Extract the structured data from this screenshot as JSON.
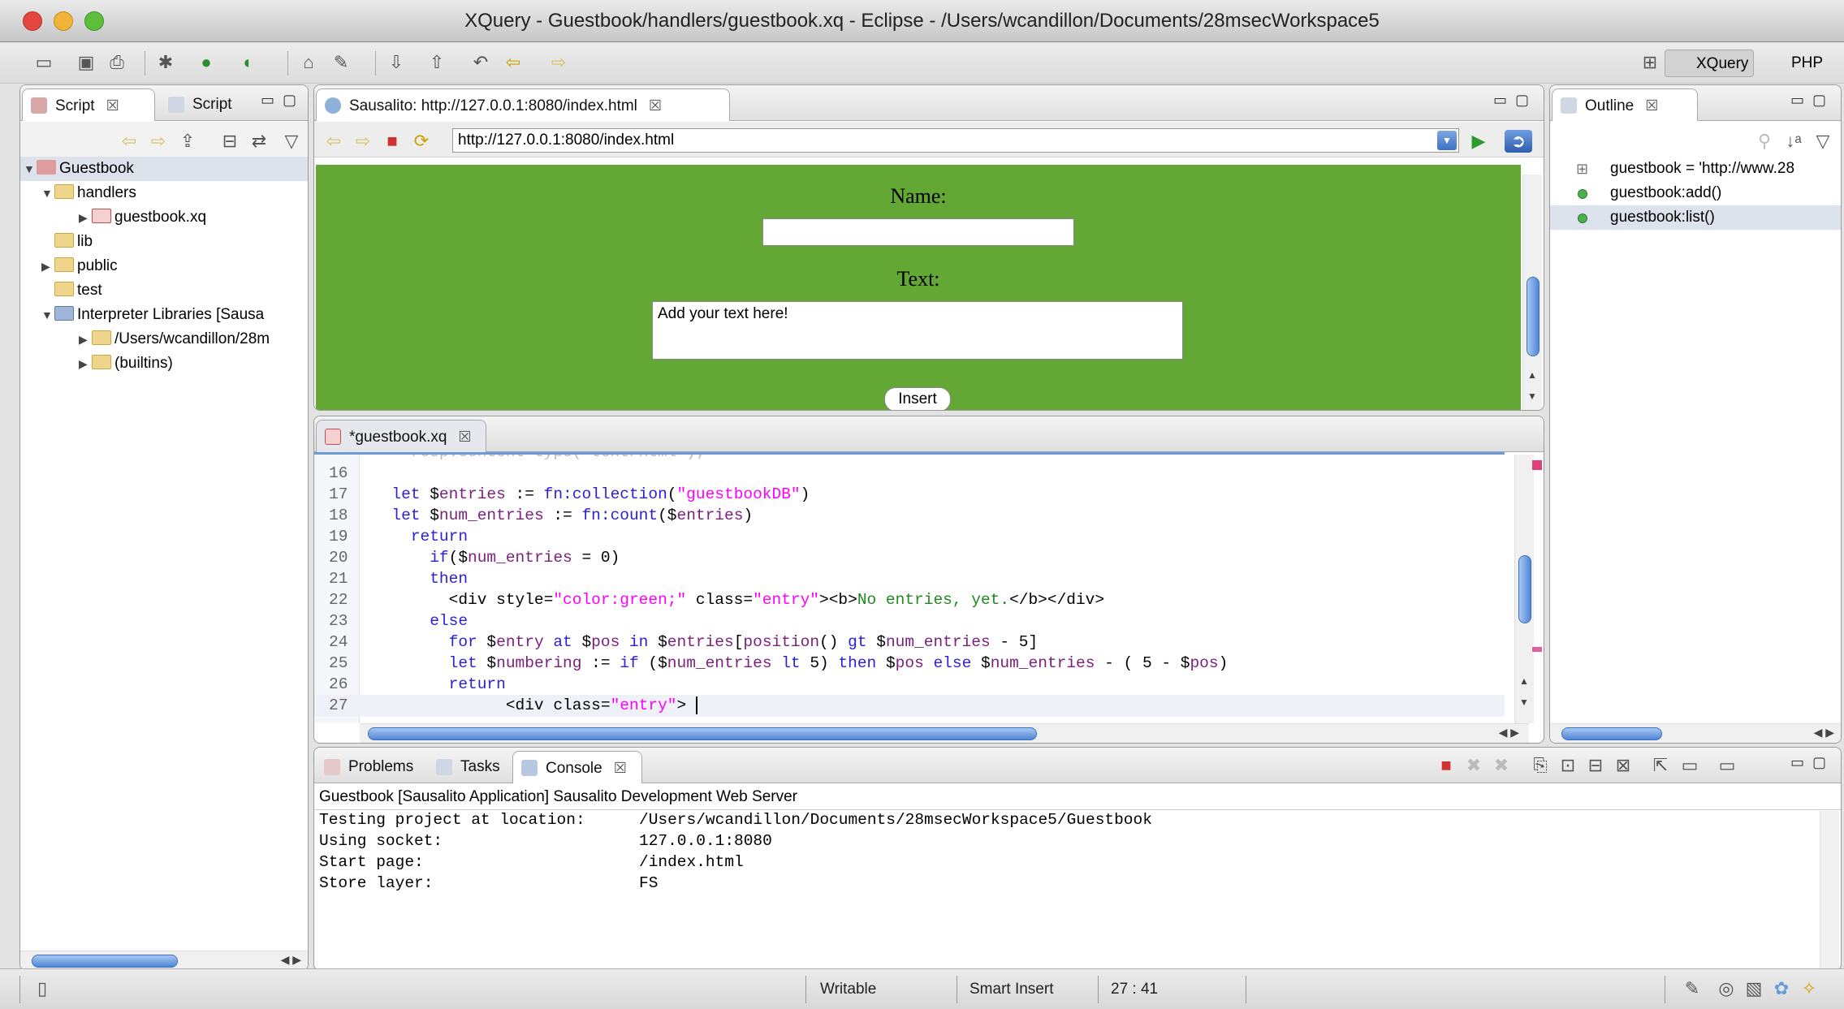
{
  "window": {
    "title": "XQuery - Guestbook/handlers/guestbook.xq - Eclipse - /Users/wcandillon/Documents/28msecWorkspace5"
  },
  "perspectives": {
    "xquery": "XQuery",
    "php": "PHP"
  },
  "left_panel": {
    "tabs": [
      {
        "label": "Script"
      },
      {
        "label": "Script"
      }
    ],
    "tree": [
      {
        "label": "Guestbook"
      },
      {
        "label": "handlers"
      },
      {
        "label": "guestbook.xq"
      },
      {
        "label": "lib"
      },
      {
        "label": "public"
      },
      {
        "label": "test"
      },
      {
        "label": "Interpreter Libraries [Sausa"
      },
      {
        "label": "/Users/wcandillon/28m"
      },
      {
        "label": "(builtins)"
      }
    ]
  },
  "browser": {
    "tab_label": "Sausalito: http://127.0.0.1:8080/index.html",
    "url": "http://127.0.0.1:8080/index.html",
    "name_label": "Name:",
    "text_label": "Text:",
    "textarea_value": "Add your text here!",
    "insert_label": "Insert"
  },
  "editor": {
    "tab_label": "*guestbook.xq",
    "line_numbers": [
      "16",
      "17",
      "18",
      "19",
      "20",
      "21",
      "22",
      "23",
      "24",
      "25",
      "26",
      "27"
    ]
  },
  "outline": {
    "tab_label": "Outline",
    "items": [
      {
        "label": "guestbook = 'http://www.28"
      },
      {
        "label": "guestbook:add()"
      },
      {
        "label": "guestbook:list()"
      }
    ]
  },
  "console": {
    "tabs": [
      {
        "label": "Problems"
      },
      {
        "label": "Tasks"
      },
      {
        "label": "Console"
      }
    ],
    "header": "Guestbook [Sausalito Application] Sausalito Development Web Server",
    "lines": [
      {
        "key": "Testing project at location:",
        "value": "/Users/wcandillon/Documents/28msecWorkspace5/Guestbook"
      },
      {
        "key": "Using socket:",
        "value": "127.0.0.1:8080"
      },
      {
        "key": "Start page:",
        "value": "/index.html"
      },
      {
        "key": "Store layer:",
        "value": "FS"
      }
    ]
  },
  "status": {
    "writable": "Writable",
    "insert_mode": "Smart Insert",
    "position": "27 : 41"
  },
  "colors": {
    "page_green": "#63a834",
    "selection": "#dde3ec",
    "accent_blue": "#4f86d8"
  }
}
